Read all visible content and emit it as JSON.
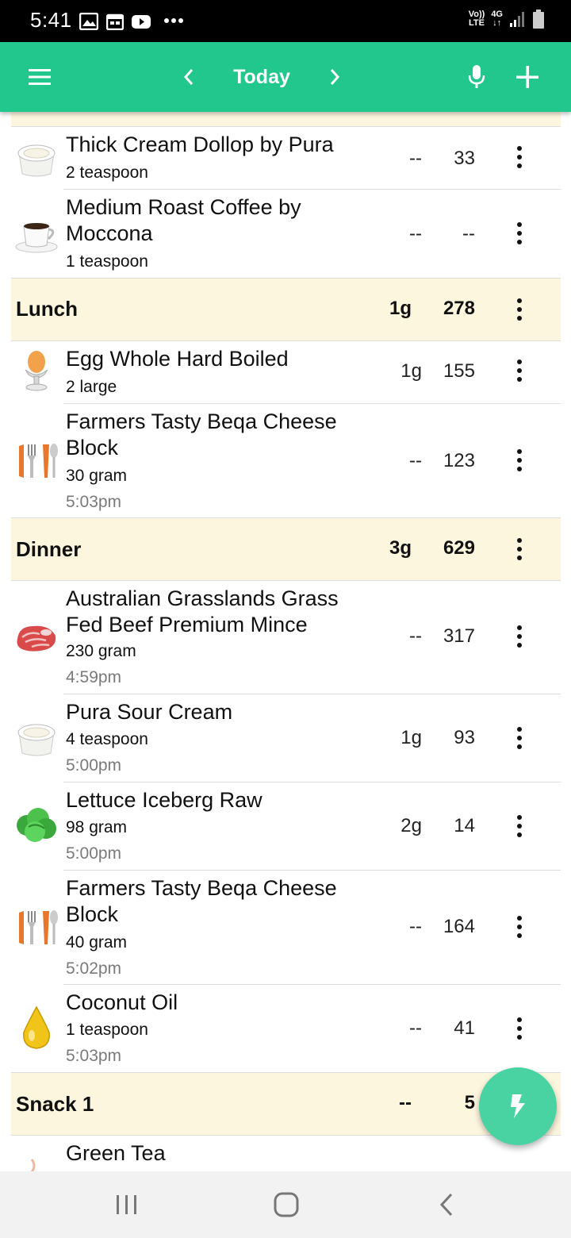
{
  "status_bar": {
    "time": "5:41",
    "network_label_top": "Vo))",
    "network_label_bottom": "LTE",
    "signal_label": "4G"
  },
  "app_bar": {
    "date_label": "Today"
  },
  "colors": {
    "accent": "#22c78e",
    "section_bg": "#fdf6de",
    "fab": "#4ad3a2"
  },
  "rows": [
    {
      "kind": "food",
      "icon": "cream-icon",
      "name": "Thick Cream Dollop by Pura",
      "serving": "2 teaspoon",
      "time": "",
      "carbs": "--",
      "calories": "33"
    },
    {
      "kind": "food",
      "icon": "coffee-cup-icon",
      "name": "Medium Roast Coffee by Moccona",
      "serving": "1 teaspoon",
      "time": "",
      "carbs": "--",
      "calories": "--"
    },
    {
      "kind": "section",
      "name": "Lunch",
      "carbs": "1g",
      "calories": "278"
    },
    {
      "kind": "food",
      "icon": "egg-cup-icon",
      "name": "Egg Whole Hard Boiled",
      "serving": "2 large",
      "time": "",
      "carbs": "1g",
      "calories": "155"
    },
    {
      "kind": "food",
      "icon": "fork-knife-icon",
      "name": "Farmers Tasty Beqa Cheese Block",
      "serving": "30 gram",
      "time": "5:03pm",
      "carbs": "--",
      "calories": "123"
    },
    {
      "kind": "section",
      "name": "Dinner",
      "carbs": "3g",
      "calories": "629"
    },
    {
      "kind": "food",
      "icon": "raw-meat-icon",
      "name": "Australian Grasslands Grass Fed Beef Premium Mince",
      "serving": "230 gram",
      "time": "4:59pm",
      "carbs": "--",
      "calories": "317"
    },
    {
      "kind": "food",
      "icon": "cream-icon",
      "name": "Pura Sour Cream",
      "serving": "4 teaspoon",
      "time": "5:00pm",
      "carbs": "1g",
      "calories": "93"
    },
    {
      "kind": "food",
      "icon": "lettuce-icon",
      "name": "Lettuce Iceberg Raw",
      "serving": "98 gram",
      "time": "5:00pm",
      "carbs": "2g",
      "calories": "14"
    },
    {
      "kind": "food",
      "icon": "fork-knife-icon",
      "name": "Farmers Tasty Beqa Cheese Block",
      "serving": "40 gram",
      "time": "5:02pm",
      "carbs": "--",
      "calories": "164"
    },
    {
      "kind": "food",
      "icon": "oil-drop-icon",
      "name": "Coconut Oil",
      "serving": "1 teaspoon",
      "time": "5:03pm",
      "carbs": "--",
      "calories": "41"
    },
    {
      "kind": "section",
      "name": "Snack 1",
      "carbs": "--",
      "calories": "5"
    },
    {
      "kind": "food",
      "icon": "tea-icon",
      "name": "Green Tea",
      "serving": "",
      "time": "",
      "carbs": "",
      "calories": ""
    }
  ]
}
